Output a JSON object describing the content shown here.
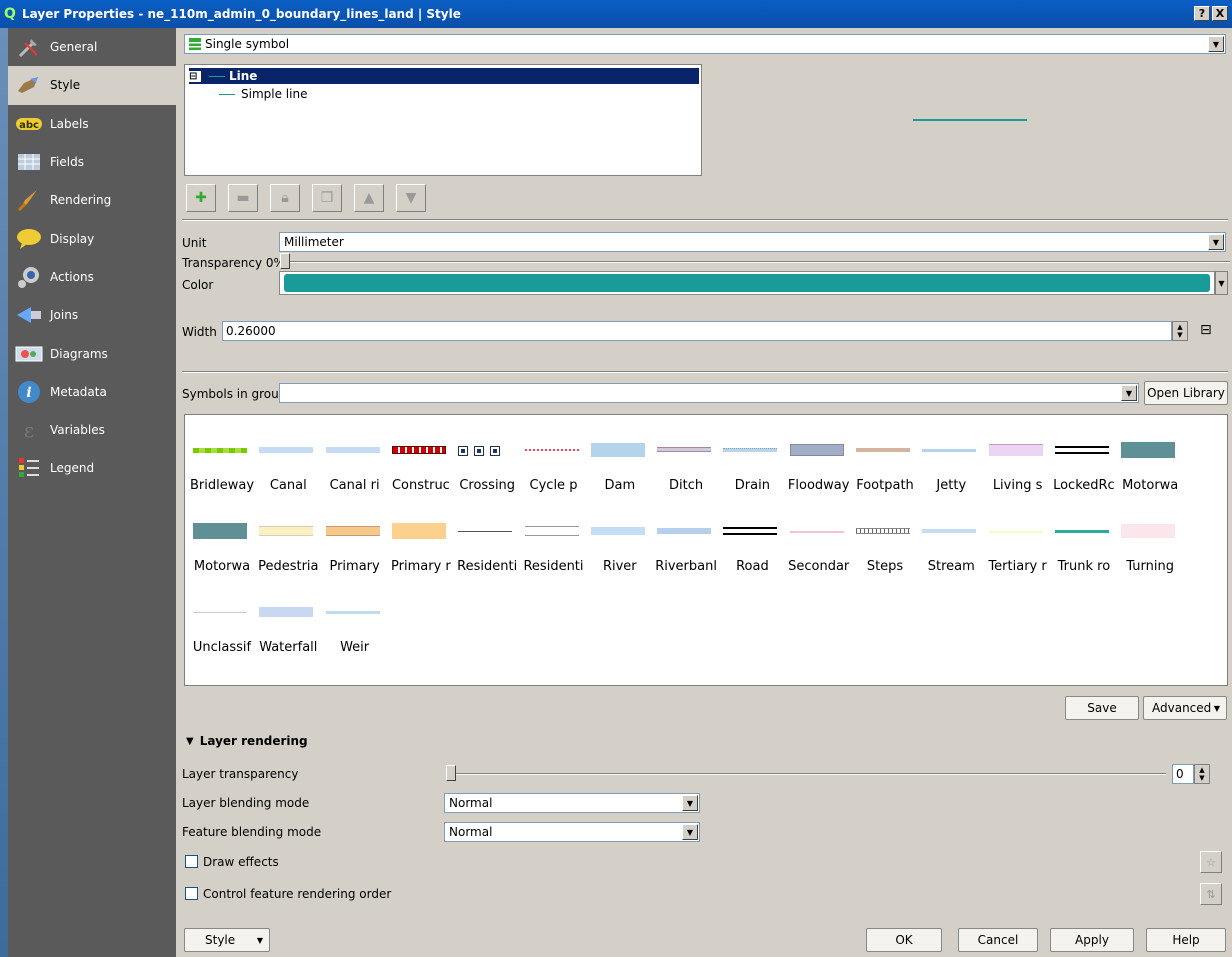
{
  "window": {
    "title": "Layer Properties - ne_110m_admin_0_boundary_lines_land | Style",
    "help_btn": "?",
    "close_btn": "X"
  },
  "sidebar": {
    "items": [
      {
        "label": "General",
        "icon": "wrench-icon"
      },
      {
        "label": "Style",
        "icon": "paintbrush-icon"
      },
      {
        "label": "Labels",
        "icon": "abc-label-icon"
      },
      {
        "label": "Fields",
        "icon": "table-icon"
      },
      {
        "label": "Rendering",
        "icon": "brush-icon"
      },
      {
        "label": "Display",
        "icon": "speech-bubble-icon"
      },
      {
        "label": "Actions",
        "icon": "gear-icon"
      },
      {
        "label": "Joins",
        "icon": "join-arrow-icon"
      },
      {
        "label": "Diagrams",
        "icon": "diagram-icon"
      },
      {
        "label": "Metadata",
        "icon": "info-icon"
      },
      {
        "label": "Variables",
        "icon": "epsilon-icon"
      },
      {
        "label": "Legend",
        "icon": "legend-icon"
      }
    ],
    "active_index": 1
  },
  "renderer": {
    "selected": "Single symbol"
  },
  "symbol_tree": {
    "root_label": "Line",
    "child_label": "Simple line",
    "expander": "⊟"
  },
  "layer_props": {
    "unit_label": "Unit",
    "unit_value": "Millimeter",
    "transparency_label": "Transparency 0%",
    "color_label": "Color",
    "color_value": "#1b9a9a",
    "width_label": "Width",
    "width_value": "0.26000"
  },
  "symbols": {
    "group_label": "Symbols in group",
    "group_value": "",
    "open_library": "Open Library",
    "items": [
      {
        "name": "Bridleway",
        "swatch": "bridleway"
      },
      {
        "name": "Canal",
        "swatch": "lightblue"
      },
      {
        "name": "Canal ri",
        "swatch": "lightblue"
      },
      {
        "name": "Construc",
        "swatch": "construction"
      },
      {
        "name": "Crossing",
        "swatch": "crossing"
      },
      {
        "name": "Cycle p",
        "swatch": "cycle"
      },
      {
        "name": "Dam",
        "swatch": "dam"
      },
      {
        "name": "Ditch",
        "swatch": "ditch"
      },
      {
        "name": "Drain",
        "swatch": "drain"
      },
      {
        "name": "Floodway",
        "swatch": "floodway"
      },
      {
        "name": "Footpath",
        "swatch": "footpath"
      },
      {
        "name": "Jetty",
        "swatch": "jetty"
      },
      {
        "name": "Living s",
        "swatch": "living"
      },
      {
        "name": "LockedRc",
        "swatch": "locked"
      },
      {
        "name": "Motorwa",
        "swatch": "motorway"
      },
      {
        "name": "Motorwa",
        "swatch": "motorway"
      },
      {
        "name": "Pedestria",
        "swatch": "pedestrian"
      },
      {
        "name": "Primary",
        "swatch": "primary"
      },
      {
        "name": "Primary r",
        "swatch": "primary2"
      },
      {
        "name": "Residenti",
        "swatch": "residential"
      },
      {
        "name": "Residenti",
        "swatch": "residential2"
      },
      {
        "name": "River",
        "swatch": "river"
      },
      {
        "name": "Riverbanl",
        "swatch": "riverbank"
      },
      {
        "name": "Road",
        "swatch": "road"
      },
      {
        "name": "Secondar",
        "swatch": "secondary"
      },
      {
        "name": "Steps",
        "swatch": "steps"
      },
      {
        "name": "Stream",
        "swatch": "stream"
      },
      {
        "name": "Tertiary r",
        "swatch": "tertiary"
      },
      {
        "name": "Trunk ro",
        "swatch": "trunk"
      },
      {
        "name": "Turning",
        "swatch": "turning"
      },
      {
        "name": "Unclassif",
        "swatch": "unclassified"
      },
      {
        "name": "Waterfall",
        "swatch": "waterfall"
      },
      {
        "name": "Weir",
        "swatch": "weir"
      }
    ]
  },
  "actions": {
    "save": "Save",
    "advanced": "Advanced"
  },
  "layer_rendering": {
    "header": "Layer rendering",
    "transparency_label": "Layer transparency",
    "transparency_value": "0",
    "blending_label": "Layer blending mode",
    "blending_value": "Normal",
    "feature_blending_label": "Feature blending mode",
    "feature_blending_value": "Normal",
    "draw_effects": "Draw effects",
    "control_order": "Control feature rendering order"
  },
  "footer": {
    "style": "Style",
    "ok": "OK",
    "cancel": "Cancel",
    "apply": "Apply",
    "help": "Help"
  }
}
